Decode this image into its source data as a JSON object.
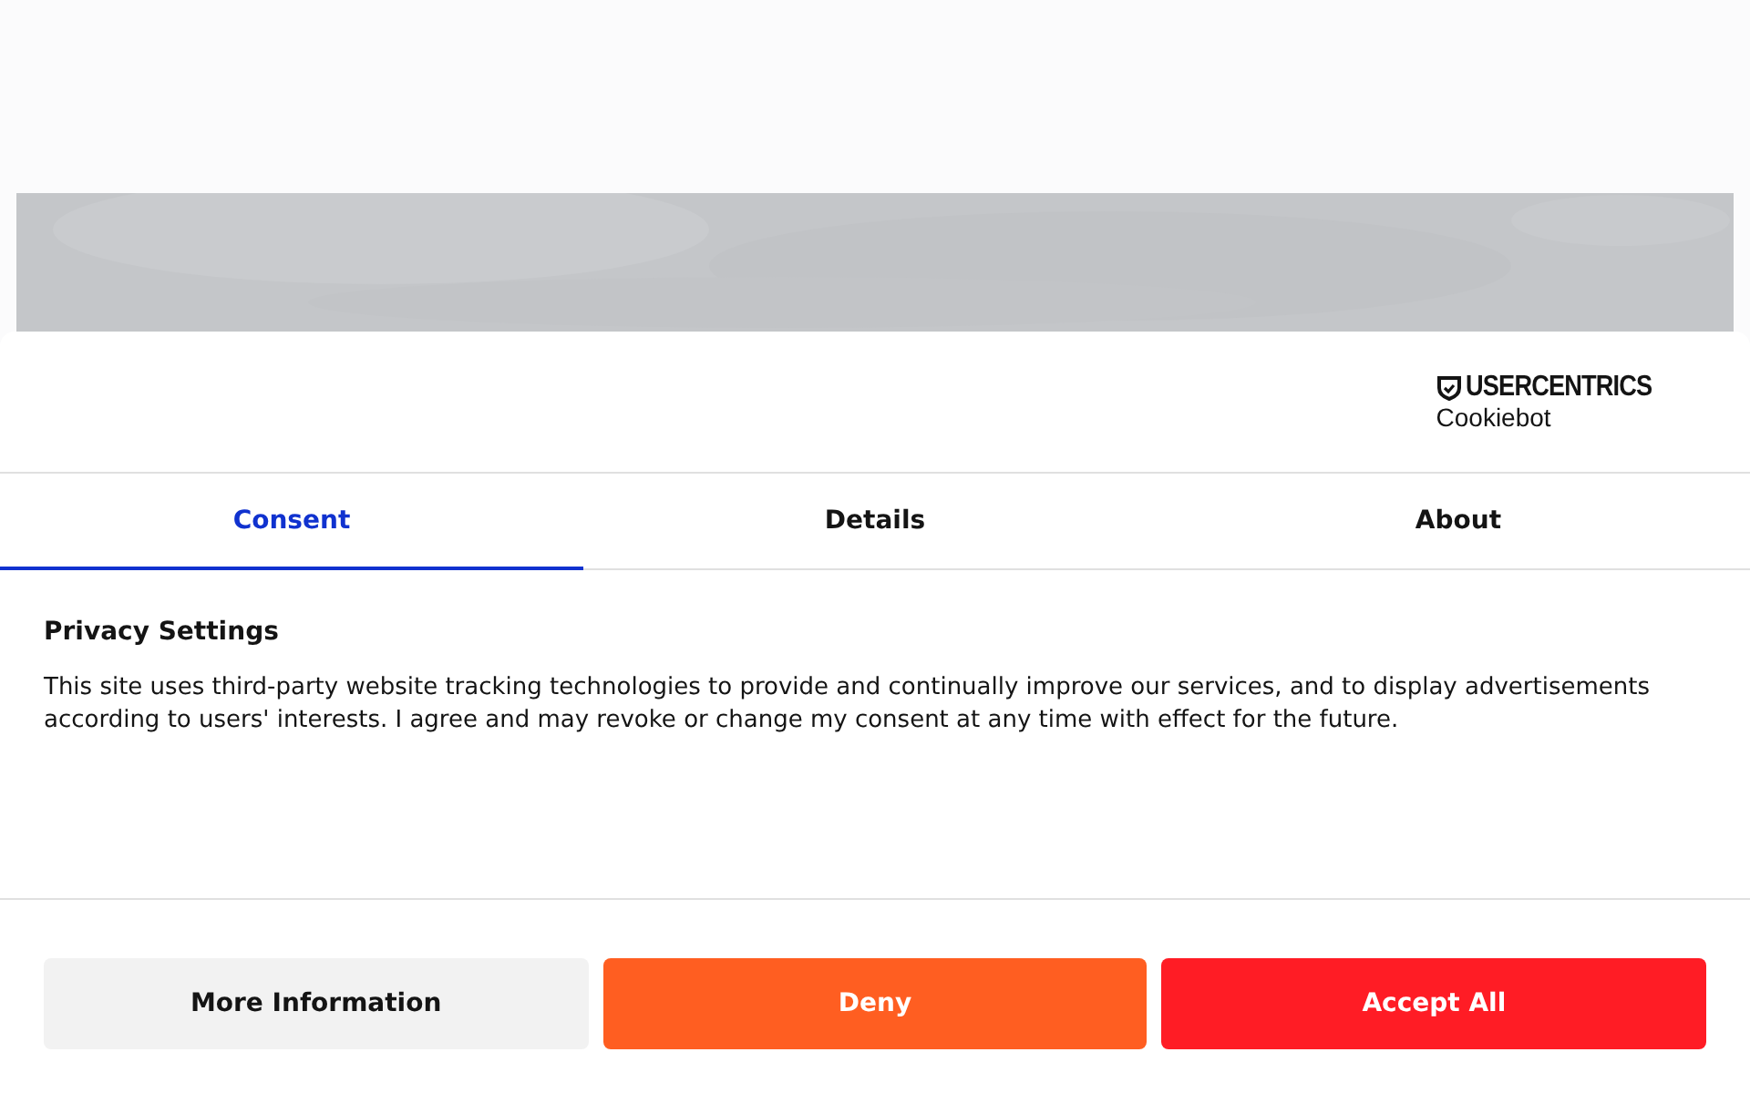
{
  "dialog": {
    "brand": {
      "name": "USERCENTRICS",
      "product": "Cookiebot"
    },
    "tabs": [
      {
        "label": "Consent",
        "selected": true
      },
      {
        "label": "Details",
        "selected": false
      },
      {
        "label": "About",
        "selected": false
      }
    ],
    "title": "Privacy Settings",
    "text": "This site uses third-party website tracking technologies to provide and continually improve our services, and to display advertisements according to users' interests. I agree and may revoke or change my consent at any time with effect for the future.",
    "buttons": [
      {
        "label": "More Information",
        "kind": "neutral"
      },
      {
        "label": "Deny",
        "kind": "deny"
      },
      {
        "label": "Accept All",
        "kind": "accept"
      }
    ]
  }
}
